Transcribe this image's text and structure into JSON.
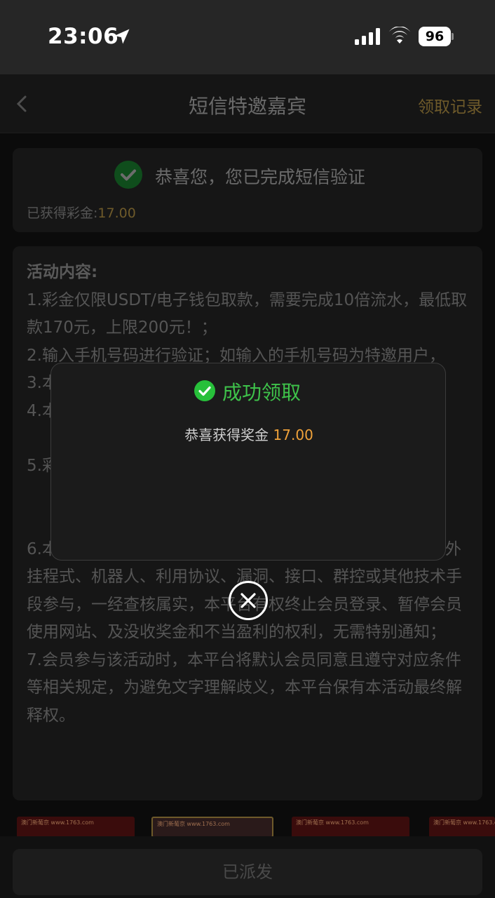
{
  "status_bar": {
    "time": "23:06",
    "battery": "96"
  },
  "nav": {
    "title": "短信特邀嘉宾",
    "record_link": "领取记录"
  },
  "verify_card": {
    "message": "恭喜您，您已完成短信验证",
    "bonus_label": "已获得彩金:",
    "bonus_amount": "17.00"
  },
  "rules": {
    "title": "活动内容:",
    "items": [
      "1.彩金仅限USDT/电子钱包取款，需要完成10倍流水，最低取款170元，上限200元！；",
      "2.输入手机号码进行验证；如输入的手机号码为特邀用户，",
      "3.本",
      "4.本",
      "5.彩",
      "6.本活动仅限账号本人领取奖励，禁止租借账号，不得使用外挂程式、机器人、利用协议、漏洞、接口、群控或其他技术手段参与，一经查核属实，本平台有权终止会员登录、暂停会员使用网站、及没收奖金和不当盈利的权利，无需特别通知；",
      "7.会员参与该活动时，本平台将默认会员同意且遵守对应条件等相关规定，为避免文字理解歧义，本平台保有本活动最终解释权。"
    ]
  },
  "banners": [
    "澳门新葡京 www.1763.com",
    "澳门新葡京 www.1763.com",
    "澳门新葡京 www.1763.com",
    "澳门新葡京 www.1763.com"
  ],
  "bottom": {
    "button_label": "已派发"
  },
  "modal": {
    "title": "成功领取",
    "message_prefix": "恭喜获得奖金",
    "amount": "17.00"
  },
  "colors": {
    "success_green": "#27c03a",
    "amount_orange": "#f0a23a",
    "gold_link": "#b8902e"
  }
}
